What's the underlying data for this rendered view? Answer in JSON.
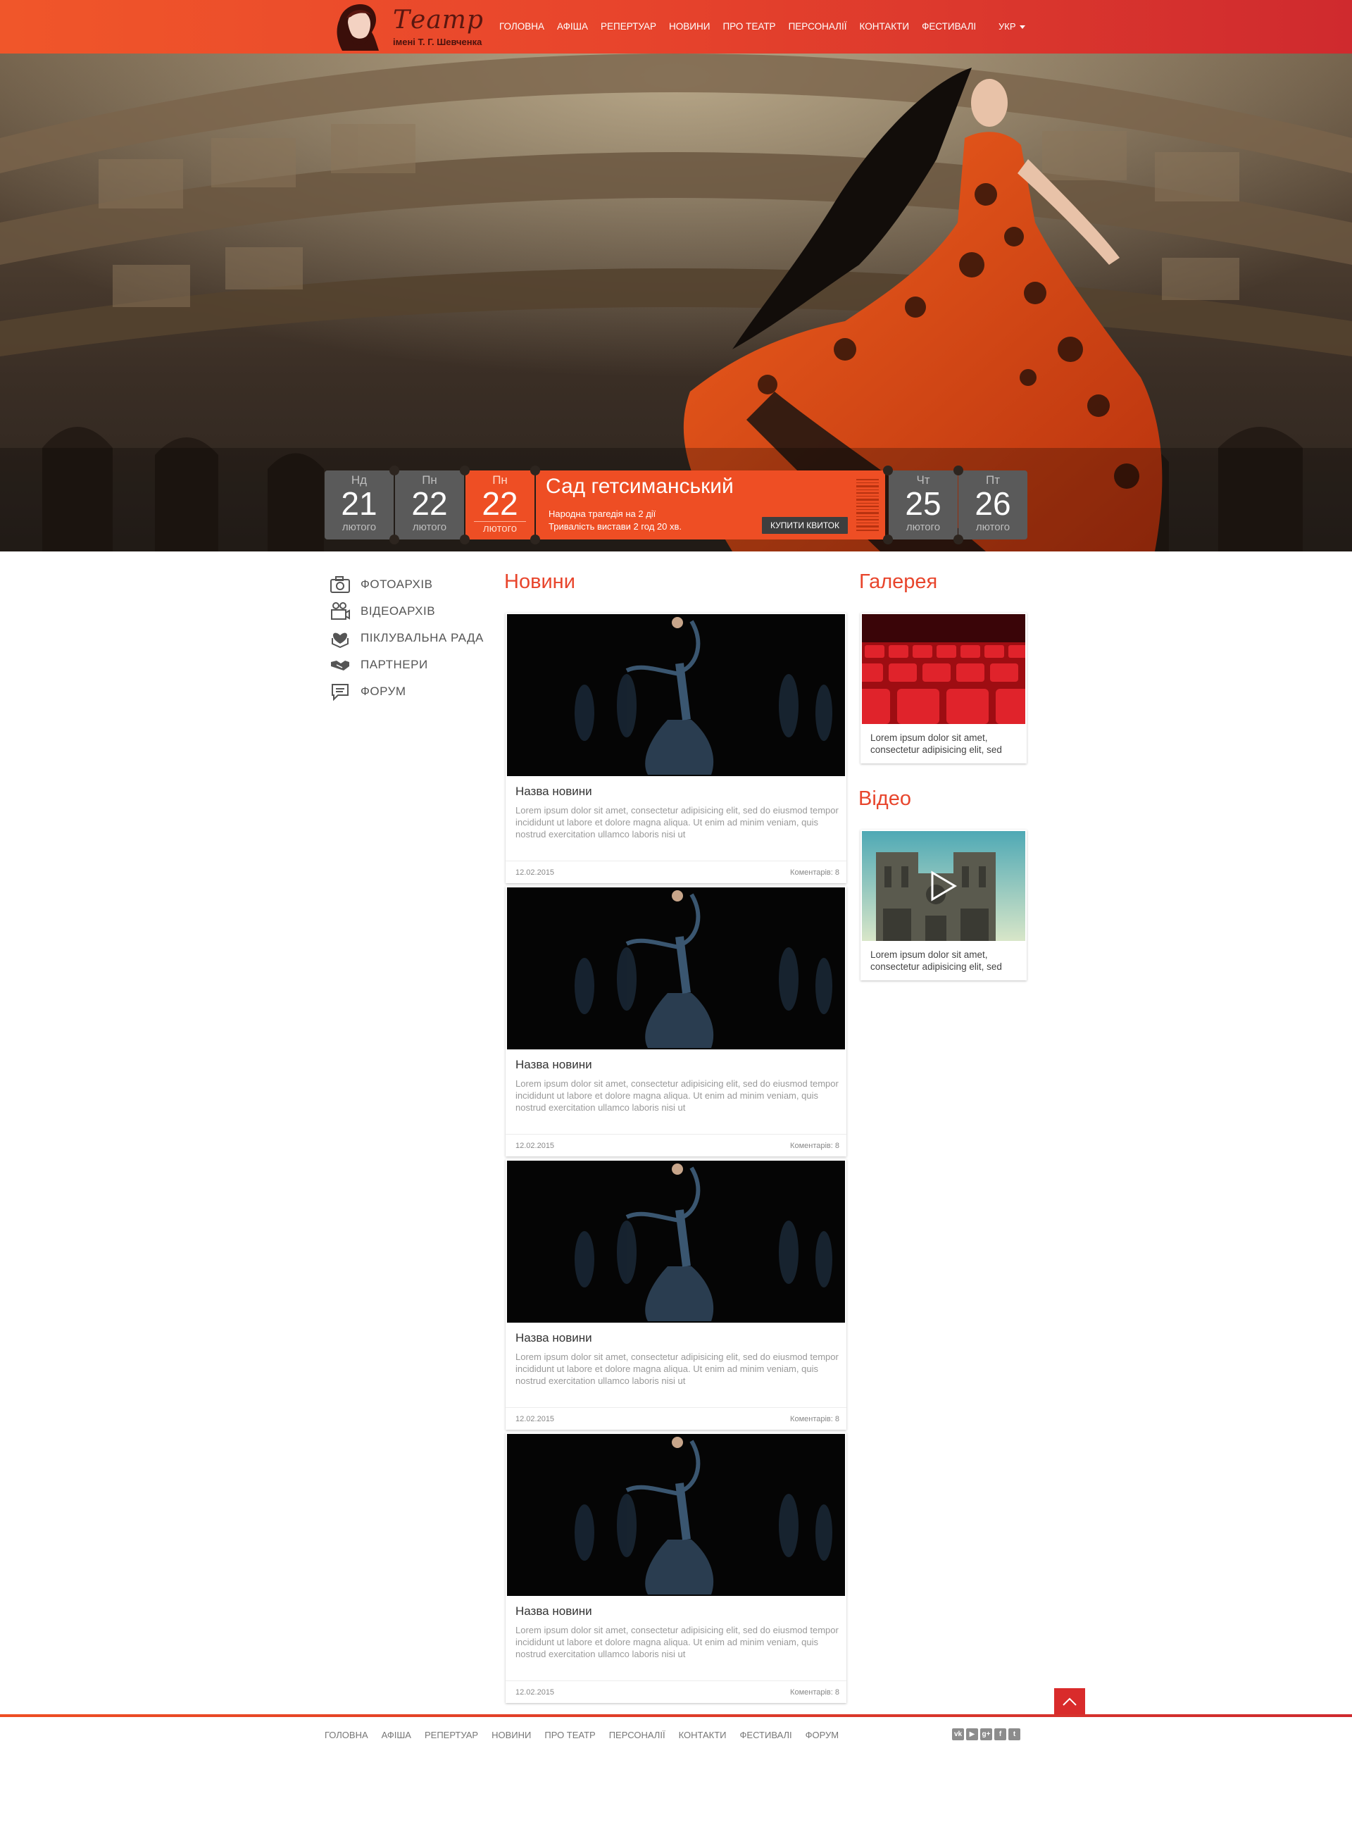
{
  "header": {
    "logo_title": "Театр",
    "logo_subtitle": "імені Т. Г. Шевченка",
    "nav": [
      "ГОЛОВНА",
      "АФІША",
      "РЕПЕРТУАР",
      "НОВИНИ",
      "ПРО ТЕАТР",
      "ПЕРСОНАЛІЇ",
      "КОНТАКТИ",
      "ФЕСТИВАЛІ"
    ],
    "language": "УКР"
  },
  "calendar": {
    "days": [
      {
        "dow": "Нд",
        "num": "21",
        "month": "лютого"
      },
      {
        "dow": "Пн",
        "num": "22",
        "month": "лютого"
      },
      {
        "dow": "Пн",
        "num": "22",
        "month": "лютого"
      },
      {
        "dow": "Чт",
        "num": "25",
        "month": "лютого"
      },
      {
        "dow": "Пт",
        "num": "26",
        "month": "лютого"
      }
    ],
    "event": {
      "title": "Сад гетсиманський",
      "line1": "Народна трагедія на 2 дії",
      "line2": "Тривалість вистави 2 год 20 хв.",
      "buy_label": "КУПИТИ КВИТОК"
    }
  },
  "sidebar": {
    "items": [
      {
        "label": "ФОТОАРХІВ",
        "icon": "camera-icon"
      },
      {
        "label": "ВІДЕОАРХІВ",
        "icon": "video-camera-icon"
      },
      {
        "label": "ПІКЛУВАЛЬНА РАДА",
        "icon": "care-hands-icon"
      },
      {
        "label": "ПАРТНЕРИ",
        "icon": "handshake-icon"
      },
      {
        "label": "ФОРУМ",
        "icon": "chat-icon"
      }
    ]
  },
  "news": {
    "title": "Новини",
    "items": [
      {
        "name": "Назва новини",
        "text": "Lorem ipsum dolor sit amet, consectetur adipisicing elit, sed do eiusmod tempor incididunt ut labore et dolore magna aliqua. Ut enim ad minim veniam, quis nostrud exercitation ullamco laboris nisi ut",
        "date": "12.02.2015",
        "comments": "Коментарів: 8"
      },
      {
        "name": "Назва новини",
        "text": "Lorem ipsum dolor sit amet, consectetur adipisicing elit, sed do eiusmod tempor incididunt ut labore et dolore magna aliqua. Ut enim ad minim veniam, quis nostrud exercitation ullamco laboris nisi ut",
        "date": "12.02.2015",
        "comments": "Коментарів: 8"
      },
      {
        "name": "Назва новини",
        "text": "Lorem ipsum dolor sit amet, consectetur adipisicing elit, sed do eiusmod tempor incididunt ut labore et dolore magna aliqua. Ut enim ad minim veniam, quis nostrud exercitation ullamco laboris nisi ut",
        "date": "12.02.2015",
        "comments": "Коментарів: 8"
      },
      {
        "name": "Назва новини",
        "text": "Lorem ipsum dolor sit amet, consectetur adipisicing elit, sed do eiusmod tempor incididunt ut labore et dolore magna aliqua. Ut enim ad minim veniam, quis nostrud exercitation ullamco laboris nisi ut",
        "date": "12.02.2015",
        "comments": "Коментарів: 8"
      }
    ]
  },
  "gallery": {
    "title": "Галерея",
    "text": "Lorem ipsum dolor sit amet, consectetur adipisicing elit, sed"
  },
  "video": {
    "title": "Відео",
    "text": "Lorem ipsum dolor sit amet, consectetur adipisicing elit, sed"
  },
  "footer": {
    "nav": [
      "ГОЛОВНА",
      "АФІША",
      "РЕПЕРТУАР",
      "НОВИНИ",
      "ПРО ТЕАТР",
      "ПЕРСОНАЛІЇ",
      "КОНТАКТИ",
      "ФЕСТИВАЛІ",
      "ФОРУМ"
    ],
    "socials": [
      "vk-icon",
      "youtube-icon",
      "google-plus-icon",
      "facebook-icon",
      "twitter-icon"
    ]
  },
  "colors": {
    "accent": "#ee4e24",
    "header_end": "#cf2a2e",
    "calendar_gray": "#5a5a5a"
  }
}
